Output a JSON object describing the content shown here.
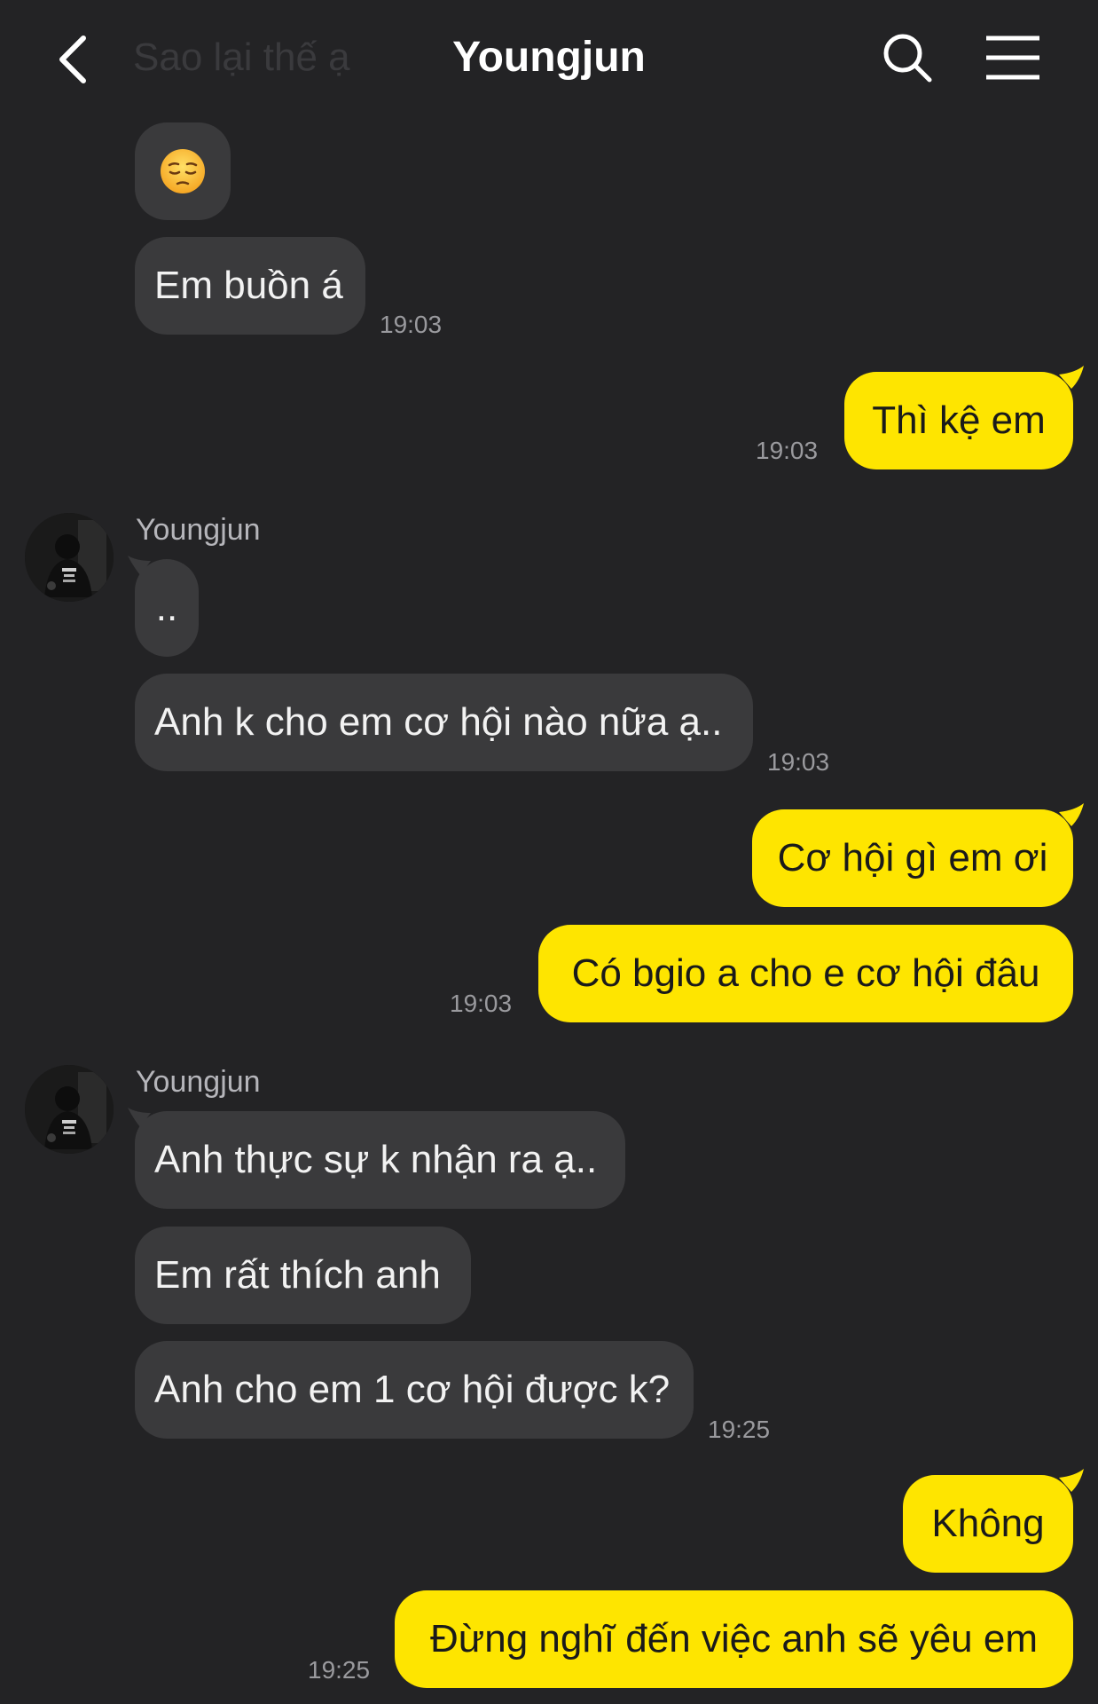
{
  "header": {
    "title": "Youngjun",
    "faded_text": "Sao lại thế ạ"
  },
  "colors": {
    "background": "#232325",
    "incoming_bubble": "#3a3a3c",
    "outgoing_bubble": "#fee500",
    "timestamp": "#9a9a9e"
  },
  "messages": [
    {
      "id": "m1",
      "direction": "incoming",
      "content": "emoji",
      "emoji": "pensive-face"
    },
    {
      "id": "m2",
      "direction": "incoming",
      "text": "Em buồn á",
      "time": "19:03"
    },
    {
      "id": "m3",
      "direction": "outgoing",
      "text": "Thì kệ em",
      "time": "19:03"
    },
    {
      "id": "m4",
      "direction": "incoming",
      "sender": "Youngjun",
      "text": ".."
    },
    {
      "id": "m5",
      "direction": "incoming",
      "text": "Anh k cho em cơ hội nào nữa ạ..",
      "time": "19:03"
    },
    {
      "id": "m6",
      "direction": "outgoing",
      "text": "Cơ hội gì em ơi"
    },
    {
      "id": "m7",
      "direction": "outgoing",
      "text": "Có bgio a cho e cơ hội đâu",
      "time": "19:03"
    },
    {
      "id": "m8",
      "direction": "incoming",
      "sender": "Youngjun",
      "text": "Anh thực sự k nhận ra ạ.."
    },
    {
      "id": "m9",
      "direction": "incoming",
      "text": "Em rất thích anh"
    },
    {
      "id": "m10",
      "direction": "incoming",
      "text": "Anh cho em 1 cơ hội được k?",
      "time": "19:25"
    },
    {
      "id": "m11",
      "direction": "outgoing",
      "text": "Không"
    },
    {
      "id": "m12",
      "direction": "outgoing",
      "text": "Đừng nghĩ đến việc anh sẽ yêu em",
      "time": "19:25"
    }
  ]
}
